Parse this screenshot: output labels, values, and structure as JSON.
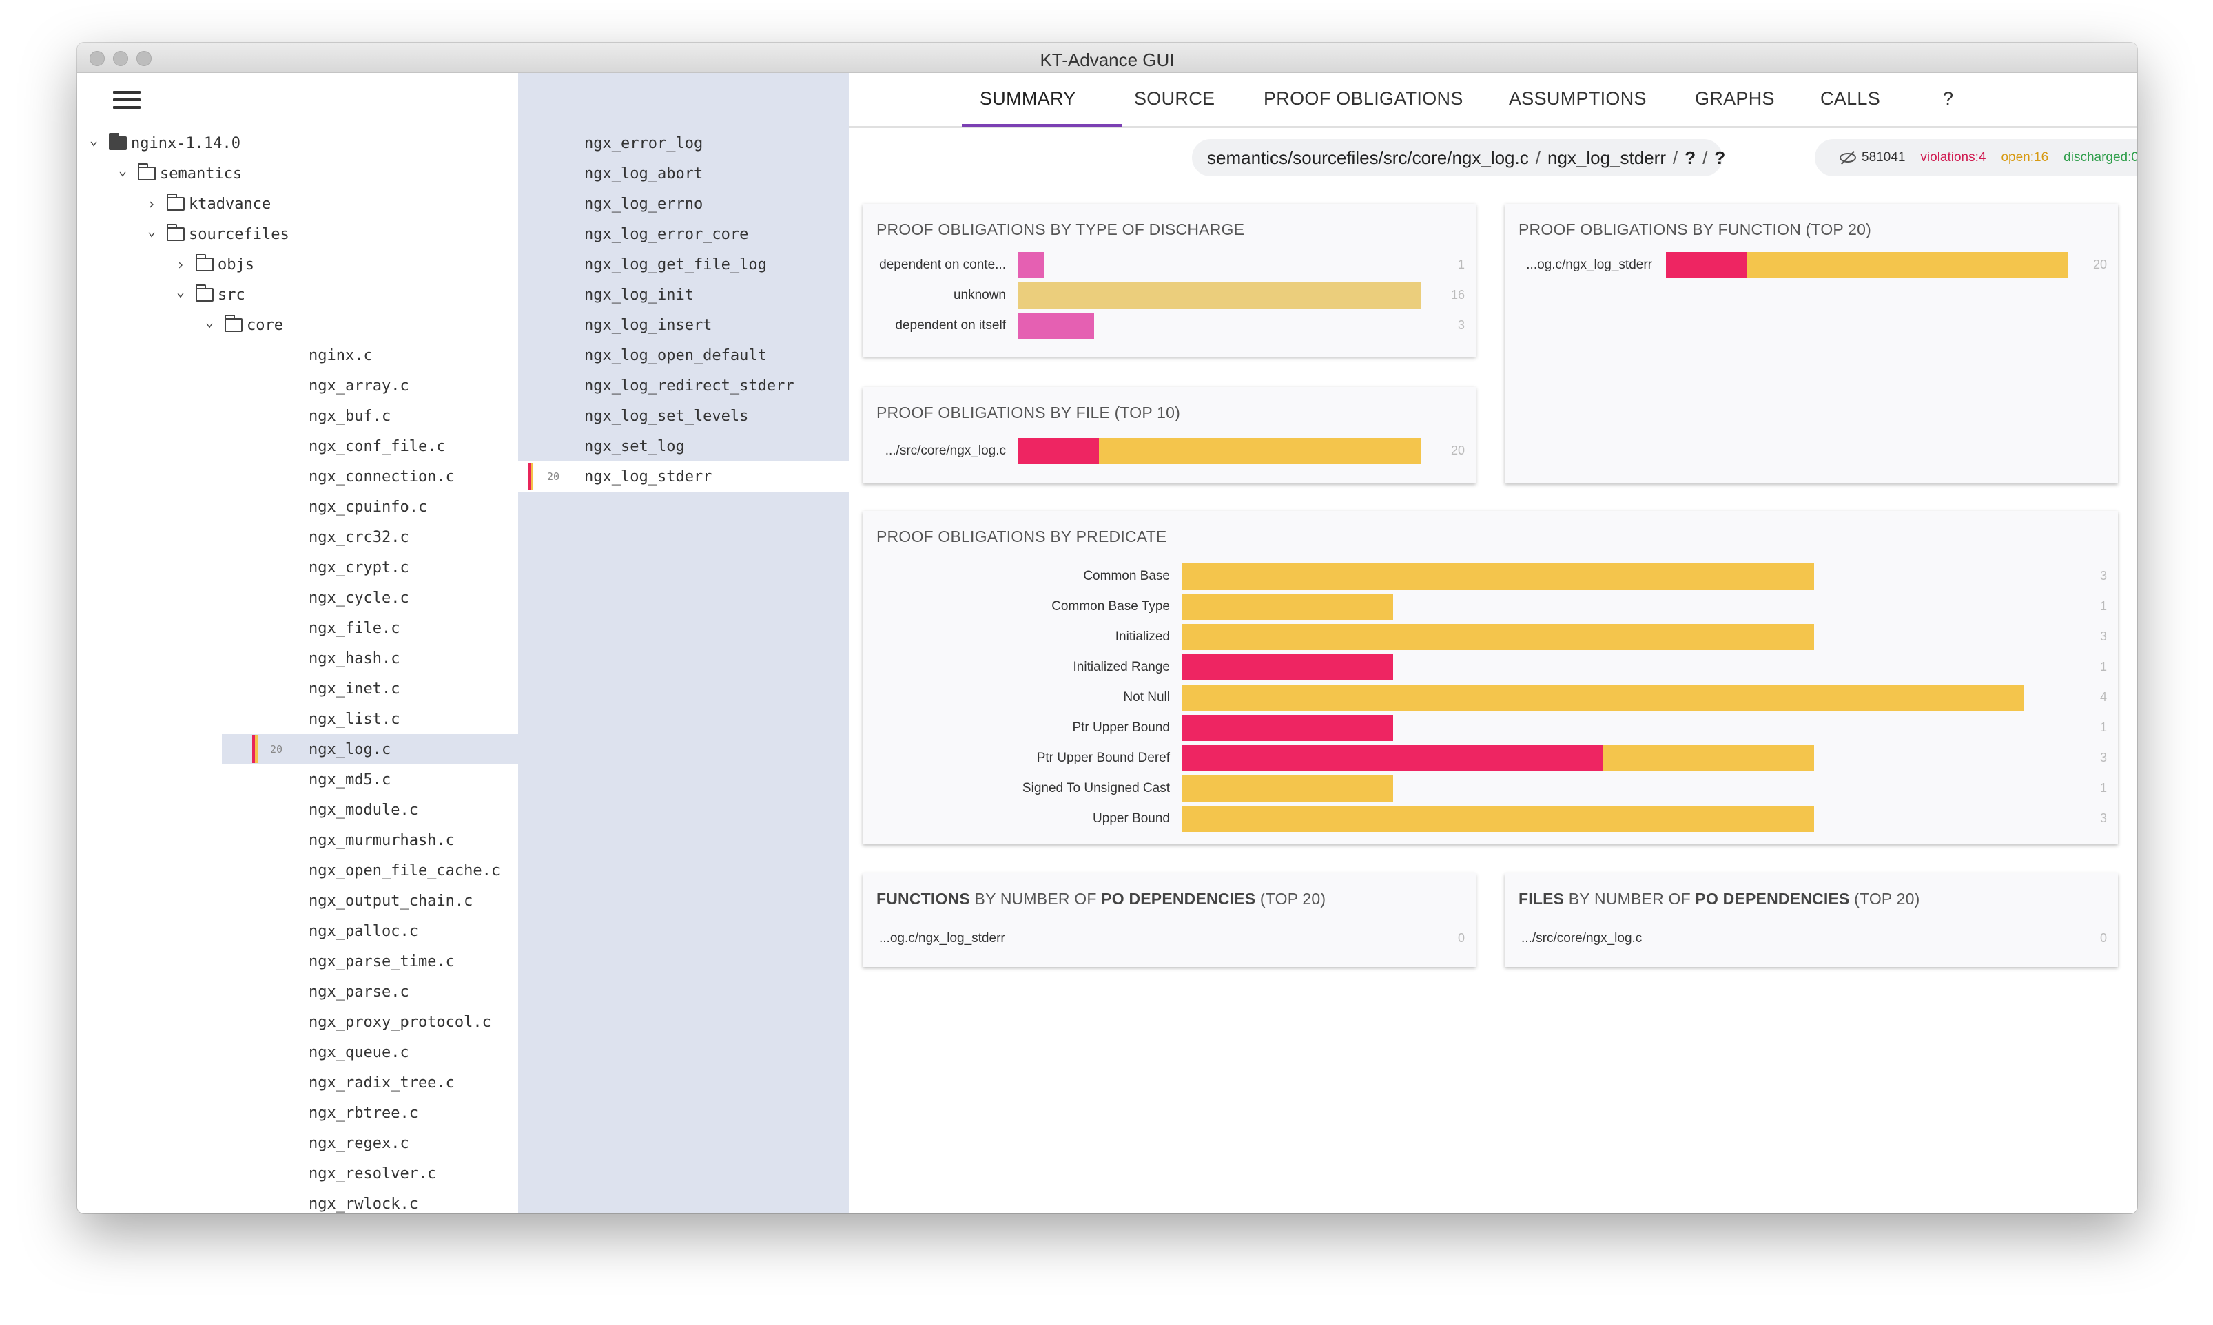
{
  "window": {
    "title": "KT-Advance GUI"
  },
  "tree": {
    "folders": [
      {
        "label": "nginx-1.14.0",
        "expanded": true,
        "level": 0
      },
      {
        "label": "semantics",
        "expanded": true,
        "level": 1
      },
      {
        "label": "ktadvance",
        "expanded": false,
        "level": 2
      },
      {
        "label": "sourcefiles",
        "expanded": true,
        "level": 2
      },
      {
        "label": "objs",
        "expanded": false,
        "level": 3
      },
      {
        "label": "src",
        "expanded": true,
        "level": 3
      },
      {
        "label": "core",
        "expanded": true,
        "level": 4
      }
    ],
    "files": [
      "nginx.c",
      "ngx_array.c",
      "ngx_buf.c",
      "ngx_conf_file.c",
      "ngx_connection.c",
      "ngx_cpuinfo.c",
      "ngx_crc32.c",
      "ngx_crypt.c",
      "ngx_cycle.c",
      "ngx_file.c",
      "ngx_hash.c",
      "ngx_inet.c",
      "ngx_list.c",
      "ngx_log.c",
      "ngx_md5.c",
      "ngx_module.c",
      "ngx_murmurhash.c",
      "ngx_open_file_cache.c",
      "ngx_output_chain.c",
      "ngx_palloc.c",
      "ngx_parse_time.c",
      "ngx_parse.c",
      "ngx_proxy_protocol.c",
      "ngx_queue.c",
      "ngx_radix_tree.c",
      "ngx_rbtree.c",
      "ngx_regex.c",
      "ngx_resolver.c",
      "ngx_rwlock.c"
    ],
    "selected_file": "ngx_log.c",
    "selected_count": "20"
  },
  "functions": {
    "items": [
      "ngx_error_log",
      "ngx_log_abort",
      "ngx_log_errno",
      "ngx_log_error_core",
      "ngx_log_get_file_log",
      "ngx_log_init",
      "ngx_log_insert",
      "ngx_log_open_default",
      "ngx_log_redirect_stderr",
      "ngx_log_set_levels",
      "ngx_set_log",
      "ngx_log_stderr"
    ],
    "selected": "ngx_log_stderr",
    "selected_count": "20"
  },
  "tabs": [
    "SUMMARY",
    "SOURCE",
    "PROOF OBLIGATIONS",
    "ASSUMPTIONS",
    "GRAPHS",
    "CALLS",
    "?"
  ],
  "active_tab": "SUMMARY",
  "path": {
    "file": "semantics/sourcefiles/src/core/ngx_log.c",
    "function": "ngx_log_stderr",
    "q1": "?",
    "q2": "?"
  },
  "stats": {
    "hidden": "581041",
    "violations": "violations:4",
    "open": "open:16",
    "discharged": "discharged:0",
    "violations_color": "#d0194f",
    "open_color": "#d79a12",
    "discharged_color": "#2e9e4a"
  },
  "colors": {
    "violation": "#ee2562",
    "open": "#f4c54c",
    "pink": "#e560b2",
    "beige": "#ebce7c"
  },
  "cards": {
    "by_discharge": {
      "title": "PROOF OBLIGATIONS BY TYPE OF DISCHARGE",
      "rows": [
        {
          "label": "dependent on conte...",
          "count": "1"
        },
        {
          "label": "unknown",
          "count": "16"
        },
        {
          "label": "dependent on itself",
          "count": "3"
        }
      ]
    },
    "by_file": {
      "title": "PROOF OBLIGATIONS BY FILE (TOP 10)",
      "rows": [
        {
          "label": ".../src/core/ngx_log.c",
          "count": "20"
        }
      ]
    },
    "by_function": {
      "title": "PROOF OBLIGATIONS BY FUNCTION (TOP 20)",
      "rows": [
        {
          "label": "...og.c/ngx_log_stderr",
          "count": "20"
        }
      ]
    },
    "by_predicate": {
      "title": "PROOF OBLIGATIONS BY PREDICATE",
      "rows": [
        {
          "label": "Common Base",
          "count": "3"
        },
        {
          "label": "Common Base Type",
          "count": "1"
        },
        {
          "label": "Initialized",
          "count": "3"
        },
        {
          "label": "Initialized Range",
          "count": "1"
        },
        {
          "label": "Not Null",
          "count": "4"
        },
        {
          "label": "Ptr Upper Bound",
          "count": "1"
        },
        {
          "label": "Ptr Upper Bound Deref",
          "count": "3"
        },
        {
          "label": "Signed To Unsigned Cast",
          "count": "1"
        },
        {
          "label": "Upper Bound",
          "count": "3"
        }
      ]
    },
    "functions_deps": {
      "title_bold1": "FUNCTIONS",
      "title_mid": " BY NUMBER OF ",
      "title_bold2": "PO DEPENDENCIES",
      "title_end": " (TOP 20)",
      "rows": [
        {
          "label": "...og.c/ngx_log_stderr",
          "count": "0"
        }
      ]
    },
    "files_deps": {
      "title_bold1": "FILES",
      "title_mid": " BY NUMBER OF ",
      "title_bold2": "PO DEPENDENCIES",
      "title_end": " (TOP 20)",
      "rows": [
        {
          "label": ".../src/core/ngx_log.c",
          "count": "0"
        }
      ]
    }
  },
  "chart_data": [
    {
      "type": "bar",
      "title": "PROOF OBLIGATIONS BY TYPE OF DISCHARGE",
      "categories": [
        "dependent on conte...",
        "unknown",
        "dependent on itself"
      ],
      "values": [
        1,
        16,
        3
      ]
    },
    {
      "type": "bar",
      "title": "PROOF OBLIGATIONS BY FILE (TOP 10)",
      "categories": [
        ".../src/core/ngx_log.c"
      ],
      "series": [
        {
          "name": "violations",
          "values": [
            4
          ]
        },
        {
          "name": "open",
          "values": [
            16
          ]
        }
      ]
    },
    {
      "type": "bar",
      "title": "PROOF OBLIGATIONS BY FUNCTION (TOP 20)",
      "categories": [
        "...og.c/ngx_log_stderr"
      ],
      "series": [
        {
          "name": "violations",
          "values": [
            4
          ]
        },
        {
          "name": "open",
          "values": [
            16
          ]
        }
      ]
    },
    {
      "type": "bar",
      "title": "PROOF OBLIGATIONS BY PREDICATE",
      "categories": [
        "Common Base",
        "Common Base Type",
        "Initialized",
        "Initialized Range",
        "Not Null",
        "Ptr Upper Bound",
        "Ptr Upper Bound Deref",
        "Signed To Unsigned Cast",
        "Upper Bound"
      ],
      "series": [
        {
          "name": "violations",
          "values": [
            0,
            0,
            0,
            1,
            0,
            1,
            2,
            0,
            0
          ]
        },
        {
          "name": "open",
          "values": [
            3,
            1,
            3,
            0,
            4,
            0,
            1,
            1,
            3
          ]
        }
      ]
    }
  ]
}
